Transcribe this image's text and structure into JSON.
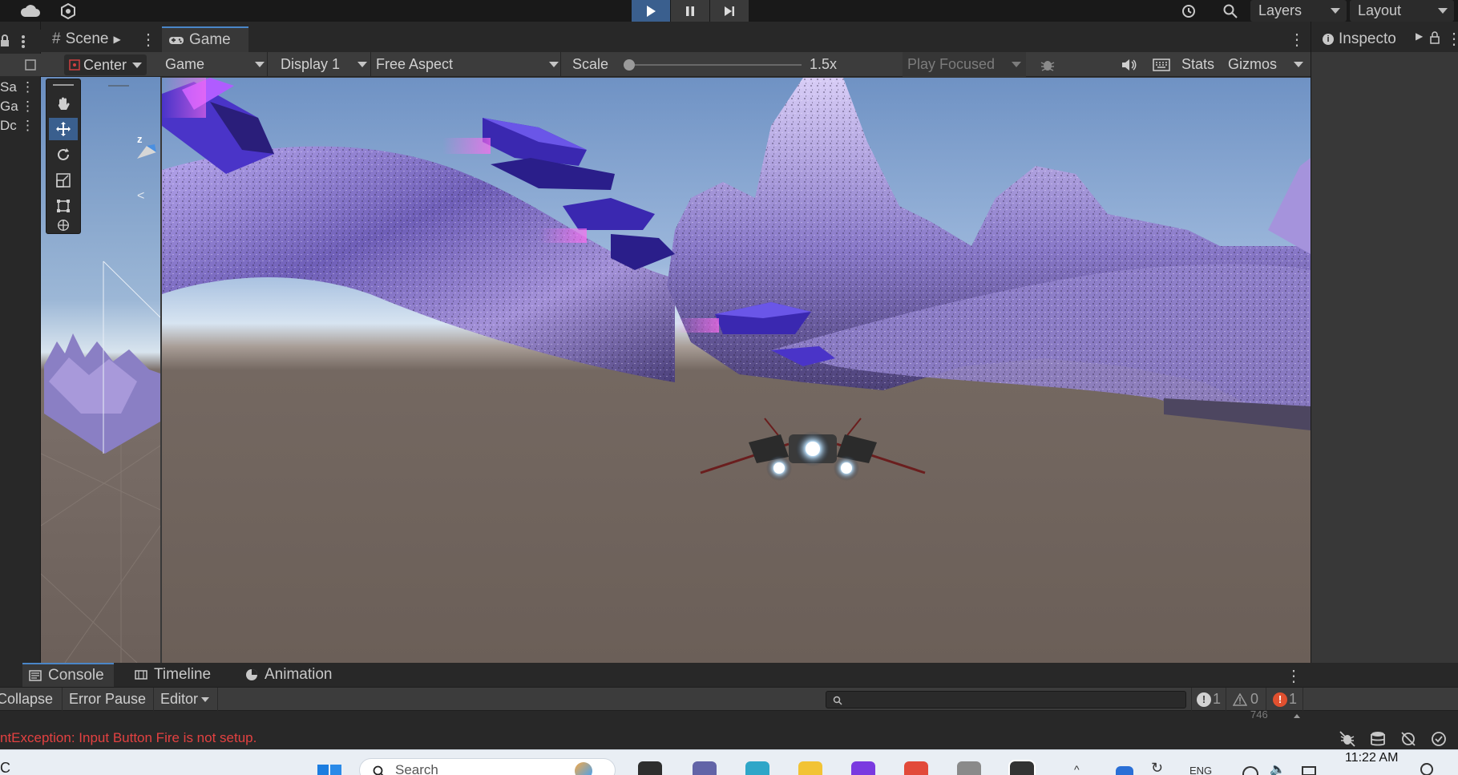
{
  "toolbar": {
    "layers_label": "Layers",
    "layout_label": "Layout"
  },
  "left_strip": {
    "labels": [
      "Sa",
      "Ga",
      "Dc"
    ]
  },
  "scene_panel": {
    "tab_label": "Scene",
    "pivot_label": "Center",
    "gizmo_axis": "z"
  },
  "game_panel": {
    "tab_label": "Game",
    "view_mode": "Game",
    "display": "Display 1",
    "aspect": "Free Aspect",
    "scale_label": "Scale",
    "scale_value": "1.5x",
    "scale_fraction": 0.0,
    "play_focused": "Play Focused",
    "stats_label": "Stats",
    "gizmos_label": "Gizmos"
  },
  "inspector": {
    "tab_label": "Inspecto"
  },
  "console": {
    "tabs": [
      {
        "label": "Console",
        "icon": "console-icon"
      },
      {
        "label": "Timeline",
        "icon": "timeline-icon"
      },
      {
        "label": "Animation",
        "icon": "animation-icon"
      }
    ],
    "collapse_label": "Collapse",
    "error_pause_label": "Error Pause",
    "editor_label": "Editor",
    "search_placeholder": "",
    "counts": {
      "info": "1",
      "warning": "0",
      "error": "1"
    },
    "scroll_count": "746",
    "error_message": "ntException: Input Button Fire is not setup."
  },
  "taskbar": {
    "search_text": "Search",
    "language": "ENG",
    "time": "11:22 AM",
    "left_char": "C"
  },
  "colors": {
    "accent": "#3a5f8e",
    "tab_highlight": "#4a86c8",
    "error_red": "#e34141",
    "sky_top": "#6f92c4",
    "ground": "#6b5f58"
  }
}
